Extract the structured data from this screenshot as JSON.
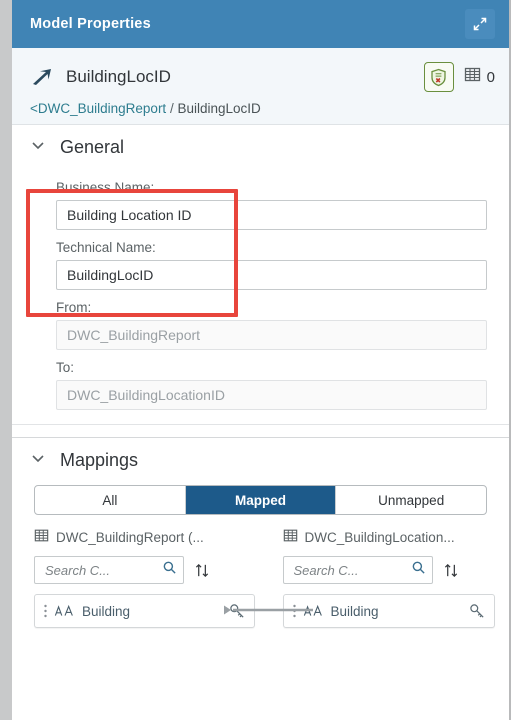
{
  "titlebar": {
    "title": "Model Properties",
    "expand_icon": "expand-icon"
  },
  "object_header": {
    "icon": "association-arrow-icon",
    "name": "BuildingLocID",
    "shield_icon": "shield-validation-icon",
    "table_icon": "table-icon",
    "count": "0",
    "breadcrumb": {
      "parent": "<DWC_BuildingReport",
      "separator": "/",
      "current": "BuildingLocID"
    }
  },
  "general": {
    "chevron": "chevron-down-icon",
    "title": "General",
    "fields": [
      {
        "label": "Business Name:",
        "value": "Building Location ID",
        "disabled": false
      },
      {
        "label": "Technical Name:",
        "value": "BuildingLocID",
        "disabled": false
      },
      {
        "label": "From:",
        "value": "DWC_BuildingReport",
        "disabled": true
      },
      {
        "label": "To:",
        "value": "DWC_BuildingLocationID",
        "disabled": true
      }
    ],
    "highlight_color": "#e8453c"
  },
  "mappings": {
    "chevron": "chevron-down-icon",
    "title": "Mappings",
    "filters": [
      {
        "label": "All",
        "active": false
      },
      {
        "label": "Mapped",
        "active": true
      },
      {
        "label": "Unmapped",
        "active": false
      }
    ],
    "columns": [
      {
        "icon": "table-icon",
        "header": "DWC_BuildingReport (...",
        "search_placeholder": "Search C...",
        "search_icon": "search-icon",
        "sort_icon": "sort-icon",
        "items": [
          {
            "grip": "drag-handle-icon",
            "type_icon": "text-type-icon",
            "name": "Building",
            "key_icon": "key-icon"
          }
        ]
      },
      {
        "icon": "table-icon",
        "header": "DWC_BuildingLocation...",
        "search_placeholder": "Search C...",
        "search_icon": "search-icon",
        "sort_icon": "sort-icon",
        "items": [
          {
            "grip": "drag-handle-icon",
            "type_icon": "text-type-icon",
            "name": "Building",
            "key_icon": "key-icon"
          }
        ]
      }
    ],
    "connector": "mapping-connector-line"
  },
  "colors": {
    "header_blue": "#4084b5",
    "active_segment": "#1d5a8a",
    "link_teal": "#2e7d8f",
    "highlight_red": "#e8453c",
    "shield_green": "#6a8f3e"
  }
}
